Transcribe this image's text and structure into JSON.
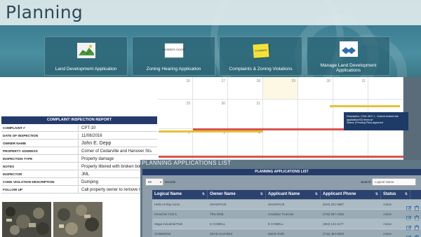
{
  "page": {
    "title": "Planning"
  },
  "tiles": [
    {
      "label": "Land Development Application",
      "icon": "land-dev-image"
    },
    {
      "label": "Zoning Hearing Application",
      "icon": "coming-soon-sign",
      "sign_text": "COMING SOON"
    },
    {
      "label": "Complaints & Zoning Violations",
      "icon": "sticky-note",
      "note_text": "Complaints"
    },
    {
      "label": "Manage Land Development Applications",
      "icon": "handshake-icon"
    }
  ],
  "calendar": {
    "days": [
      "26",
      "27",
      "28",
      "29",
      "30",
      "31",
      "",
      "29",
      "30",
      "31",
      "",
      "",
      "",
      "",
      "2",
      "3",
      "4",
      "",
      "",
      "",
      ""
    ],
    "events": [
      {
        "label": "",
        "color": "#e6c13a"
      },
      {
        "label": "",
        "color": "#d9534f"
      },
      {
        "label": "",
        "color": "#e6c13a"
      },
      {
        "label": "",
        "color": "#d9534f"
      }
    ],
    "tooltip_lines": [
      "Description: CIVIL DEV 1 - Submit revised site application/SD items w/",
      "Status: (Pending Plan) approved"
    ]
  },
  "report": {
    "title": "COMPLAINT INSPECTION REPORT",
    "rows": [
      {
        "key": "COMPLAINT #",
        "value": "CPT-10"
      },
      {
        "key": "DATE OF INSPECTION",
        "value": "11/08/2016"
      },
      {
        "key": "OWNER NAME",
        "value": "John E. Depp"
      },
      {
        "key": "PROPERTY ADDRESS",
        "value": "Corner of Cedarville and Hanover Sts."
      },
      {
        "key": "INSPECTION TYPE",
        "value": "Property damage"
      },
      {
        "key": "NOTES",
        "value": "Property littered with broken bottles."
      },
      {
        "key": "INSPECTOR",
        "value": "JML"
      },
      {
        "key": "CODE VIOLATION DESCRIPTION",
        "value": "Dumping"
      },
      {
        "key": "FOLLOW UP",
        "value": "Call property owner to remove trash."
      }
    ]
  },
  "applications": {
    "heading": "PLANNING APPLICATIONS LIST",
    "panel_title": "PLANNING APPLICATIONS LIST",
    "entries_value": "50",
    "entries_label": "records",
    "search_label": "Search:",
    "search_placeholder": "Logical Name",
    "columns": [
      "Logical Name",
      "Owner Name",
      "Applicant Name",
      "Applicant Phone",
      "Status"
    ],
    "rows": [
      [
        "Hello At Ray Acres",
        "SHAKPACE",
        "SHAKPACE",
        "(610) 321-0987",
        "Active"
      ],
      [
        "Henschel Trail S",
        "TRU DNB",
        "Jonathan Trueman",
        "(715) 867-4456",
        "Active"
      ],
      [
        "Maga Industrial Park",
        "E COMELL",
        "E COMELL",
        "(484) 124-1177",
        "Active"
      ],
      [
        "COMMONS",
        "SEAN ALVAREZ",
        "Martin Rolls",
        "(715) 494-5000",
        "Active"
      ]
    ]
  }
}
